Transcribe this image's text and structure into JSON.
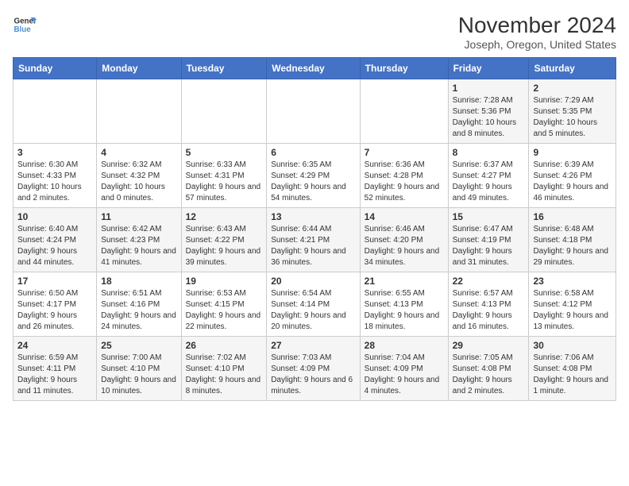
{
  "logo": {
    "line1": "General",
    "line2": "Blue"
  },
  "title": "November 2024",
  "subtitle": "Joseph, Oregon, United States",
  "days_of_week": [
    "Sunday",
    "Monday",
    "Tuesday",
    "Wednesday",
    "Thursday",
    "Friday",
    "Saturday"
  ],
  "weeks": [
    [
      {
        "day": "",
        "info": ""
      },
      {
        "day": "",
        "info": ""
      },
      {
        "day": "",
        "info": ""
      },
      {
        "day": "",
        "info": ""
      },
      {
        "day": "",
        "info": ""
      },
      {
        "day": "1",
        "info": "Sunrise: 7:28 AM\nSunset: 5:36 PM\nDaylight: 10 hours and 8 minutes."
      },
      {
        "day": "2",
        "info": "Sunrise: 7:29 AM\nSunset: 5:35 PM\nDaylight: 10 hours and 5 minutes."
      }
    ],
    [
      {
        "day": "3",
        "info": "Sunrise: 6:30 AM\nSunset: 4:33 PM\nDaylight: 10 hours and 2 minutes."
      },
      {
        "day": "4",
        "info": "Sunrise: 6:32 AM\nSunset: 4:32 PM\nDaylight: 10 hours and 0 minutes."
      },
      {
        "day": "5",
        "info": "Sunrise: 6:33 AM\nSunset: 4:31 PM\nDaylight: 9 hours and 57 minutes."
      },
      {
        "day": "6",
        "info": "Sunrise: 6:35 AM\nSunset: 4:29 PM\nDaylight: 9 hours and 54 minutes."
      },
      {
        "day": "7",
        "info": "Sunrise: 6:36 AM\nSunset: 4:28 PM\nDaylight: 9 hours and 52 minutes."
      },
      {
        "day": "8",
        "info": "Sunrise: 6:37 AM\nSunset: 4:27 PM\nDaylight: 9 hours and 49 minutes."
      },
      {
        "day": "9",
        "info": "Sunrise: 6:39 AM\nSunset: 4:26 PM\nDaylight: 9 hours and 46 minutes."
      }
    ],
    [
      {
        "day": "10",
        "info": "Sunrise: 6:40 AM\nSunset: 4:24 PM\nDaylight: 9 hours and 44 minutes."
      },
      {
        "day": "11",
        "info": "Sunrise: 6:42 AM\nSunset: 4:23 PM\nDaylight: 9 hours and 41 minutes."
      },
      {
        "day": "12",
        "info": "Sunrise: 6:43 AM\nSunset: 4:22 PM\nDaylight: 9 hours and 39 minutes."
      },
      {
        "day": "13",
        "info": "Sunrise: 6:44 AM\nSunset: 4:21 PM\nDaylight: 9 hours and 36 minutes."
      },
      {
        "day": "14",
        "info": "Sunrise: 6:46 AM\nSunset: 4:20 PM\nDaylight: 9 hours and 34 minutes."
      },
      {
        "day": "15",
        "info": "Sunrise: 6:47 AM\nSunset: 4:19 PM\nDaylight: 9 hours and 31 minutes."
      },
      {
        "day": "16",
        "info": "Sunrise: 6:48 AM\nSunset: 4:18 PM\nDaylight: 9 hours and 29 minutes."
      }
    ],
    [
      {
        "day": "17",
        "info": "Sunrise: 6:50 AM\nSunset: 4:17 PM\nDaylight: 9 hours and 26 minutes."
      },
      {
        "day": "18",
        "info": "Sunrise: 6:51 AM\nSunset: 4:16 PM\nDaylight: 9 hours and 24 minutes."
      },
      {
        "day": "19",
        "info": "Sunrise: 6:53 AM\nSunset: 4:15 PM\nDaylight: 9 hours and 22 minutes."
      },
      {
        "day": "20",
        "info": "Sunrise: 6:54 AM\nSunset: 4:14 PM\nDaylight: 9 hours and 20 minutes."
      },
      {
        "day": "21",
        "info": "Sunrise: 6:55 AM\nSunset: 4:13 PM\nDaylight: 9 hours and 18 minutes."
      },
      {
        "day": "22",
        "info": "Sunrise: 6:57 AM\nSunset: 4:13 PM\nDaylight: 9 hours and 16 minutes."
      },
      {
        "day": "23",
        "info": "Sunrise: 6:58 AM\nSunset: 4:12 PM\nDaylight: 9 hours and 13 minutes."
      }
    ],
    [
      {
        "day": "24",
        "info": "Sunrise: 6:59 AM\nSunset: 4:11 PM\nDaylight: 9 hours and 11 minutes."
      },
      {
        "day": "25",
        "info": "Sunrise: 7:00 AM\nSunset: 4:10 PM\nDaylight: 9 hours and 10 minutes."
      },
      {
        "day": "26",
        "info": "Sunrise: 7:02 AM\nSunset: 4:10 PM\nDaylight: 9 hours and 8 minutes."
      },
      {
        "day": "27",
        "info": "Sunrise: 7:03 AM\nSunset: 4:09 PM\nDaylight: 9 hours and 6 minutes."
      },
      {
        "day": "28",
        "info": "Sunrise: 7:04 AM\nSunset: 4:09 PM\nDaylight: 9 hours and 4 minutes."
      },
      {
        "day": "29",
        "info": "Sunrise: 7:05 AM\nSunset: 4:08 PM\nDaylight: 9 hours and 2 minutes."
      },
      {
        "day": "30",
        "info": "Sunrise: 7:06 AM\nSunset: 4:08 PM\nDaylight: 9 hours and 1 minute."
      }
    ]
  ]
}
